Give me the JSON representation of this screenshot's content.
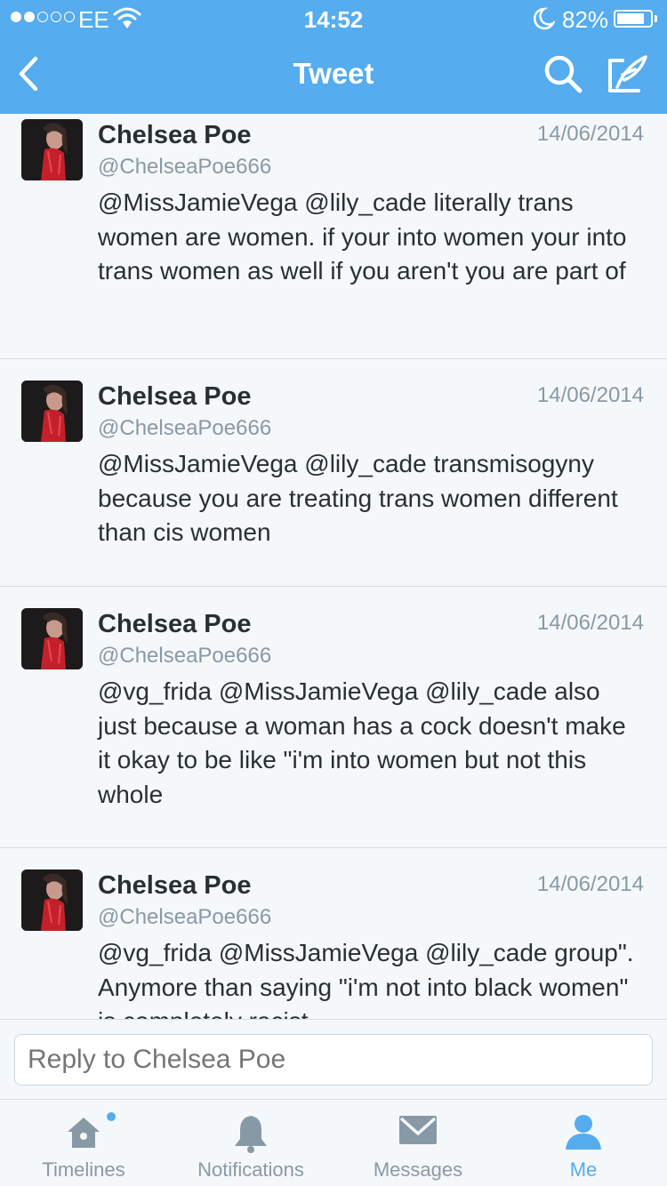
{
  "status_bar": {
    "carrier": "EE",
    "time": "14:52",
    "battery": "82%",
    "battery_level": 0.82
  },
  "nav": {
    "title": "Tweet"
  },
  "tweets": [
    {
      "name": "Chelsea Poe",
      "handle": "@ChelseaPoe666",
      "date": "14/06/2014",
      "text": "@MissJamieVega @lily_cade literally trans women are women. if your into women your into trans women as well if you aren't you are part of"
    },
    {
      "name": "Chelsea Poe",
      "handle": "@ChelseaPoe666",
      "date": "14/06/2014",
      "text": "@MissJamieVega @lily_cade transmisogyny because you are treating trans women different than cis women"
    },
    {
      "name": "Chelsea Poe",
      "handle": "@ChelseaPoe666",
      "date": "14/06/2014",
      "text": "@vg_frida @MissJamieVega @lily_cade also just because a woman has a cock doesn't make it okay to be like \"i'm into women but not this whole"
    },
    {
      "name": "Chelsea Poe",
      "handle": "@ChelseaPoe666",
      "date": "14/06/2014",
      "text": "@vg_frida @MissJamieVega @lily_cade group\". Anymore than saying \"i'm not into black women\" is completely racist"
    }
  ],
  "reply": {
    "placeholder": "Reply to Chelsea Poe"
  },
  "tabs": [
    {
      "label": "Timelines",
      "icon": "home-icon",
      "active": false,
      "notification": true
    },
    {
      "label": "Notifications",
      "icon": "bell-icon",
      "active": false,
      "notification": false
    },
    {
      "label": "Messages",
      "icon": "envelope-icon",
      "active": false,
      "notification": false
    },
    {
      "label": "Me",
      "icon": "person-icon",
      "active": true,
      "notification": false
    }
  ],
  "colors": {
    "brand": "#55acee",
    "text": "#292f33",
    "muted": "#8899a6"
  }
}
